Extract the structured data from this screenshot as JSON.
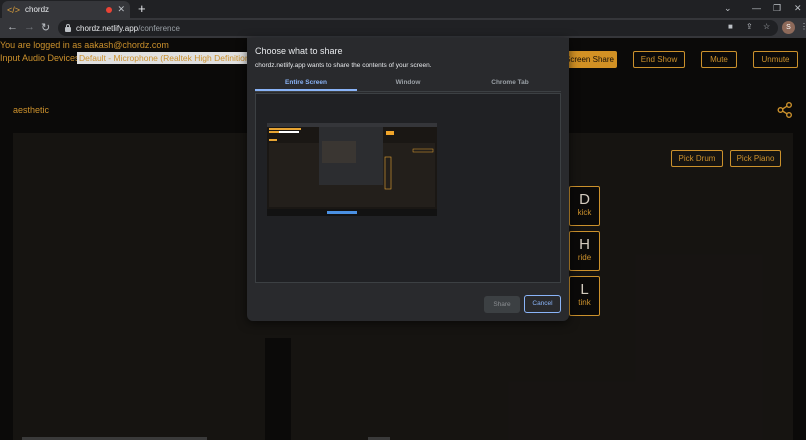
{
  "browser": {
    "tab_title": "chordz",
    "tab_favicon": "</>",
    "url_host": "chordz.netlify.app",
    "url_path": "/conference",
    "profile_initial": "S"
  },
  "page": {
    "login_text": "You are logged in as aakash@chordz.com",
    "audio_label": "Input Audio Devices:",
    "audio_selected": "Default - Microphone (Realtek High Definition Audio)",
    "buttons": {
      "screen_share": "Screen Share",
      "end_show": "End Show",
      "mute": "Mute",
      "unmute": "Unmute",
      "pick_drum": "Pick Drum",
      "pick_piano": "Pick Piano"
    },
    "room_name": "aesthetic",
    "pads": [
      {
        "key": "D",
        "name": "kick"
      },
      {
        "key": "H",
        "name": "ride"
      },
      {
        "key": "L",
        "name": "tink"
      }
    ]
  },
  "dialog": {
    "title": "Choose what to share",
    "subtitle": "chordz.netlify.app wants to share the contents of your screen.",
    "tabs": [
      "Entire Screen",
      "Window",
      "Chrome Tab"
    ],
    "active_tab": "Entire Screen",
    "share_label": "Share",
    "cancel_label": "Cancel"
  },
  "colors": {
    "accent": "#e8a533",
    "dialog_bg": "#292a2d",
    "dialog_accent": "#8ab4f8"
  }
}
